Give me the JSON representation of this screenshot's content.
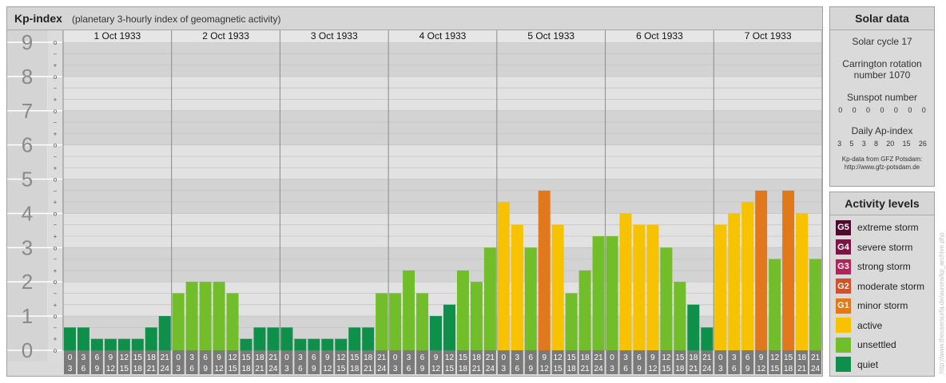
{
  "header": {
    "title": "Kp-index",
    "subtitle": "(planetary 3-hourly index of geomagnetic activity)"
  },
  "chart_data": {
    "type": "bar",
    "y_levels": [
      "0",
      "1",
      "2",
      "3",
      "4",
      "5",
      "6",
      "7",
      "8",
      "9"
    ],
    "y_minor_marks": [
      "o",
      "+",
      "−"
    ],
    "ylim": [
      0,
      9
    ],
    "days": [
      "1 Oct 1933",
      "2 Oct 1933",
      "3 Oct 1933",
      "4 Oct 1933",
      "5 Oct 1933",
      "6 Oct 1933",
      "7 Oct 1933"
    ],
    "interval_start_labels": [
      "0",
      "3",
      "6",
      "9",
      "12",
      "15",
      "18",
      "21"
    ],
    "interval_end_labels": [
      "3",
      "6",
      "9",
      "12",
      "15",
      "18",
      "21",
      "24"
    ],
    "kp_values": [
      [
        0.667,
        0.667,
        0.333,
        0.333,
        0.333,
        0.333,
        0.667,
        1.0
      ],
      [
        1.667,
        2.0,
        2.0,
        2.0,
        1.667,
        0.333,
        0.667,
        0.667
      ],
      [
        0.667,
        0.333,
        0.333,
        0.333,
        0.333,
        0.667,
        0.667,
        1.667
      ],
      [
        1.667,
        2.333,
        1.667,
        1.0,
        1.333,
        2.333,
        2.0,
        3.0
      ],
      [
        4.333,
        3.667,
        3.0,
        4.667,
        3.667,
        1.667,
        2.333,
        3.333
      ],
      [
        3.333,
        4.0,
        3.667,
        3.667,
        3.0,
        2.0,
        1.333,
        0.667
      ],
      [
        3.667,
        4.0,
        4.333,
        4.667,
        2.667,
        4.667,
        4.0,
        2.667
      ]
    ],
    "colors": {
      "quiet": "#0e8f4a",
      "unsettled": "#72bd2a",
      "active": "#f7c200",
      "G1": "#e2781c",
      "G2": "#d1512a",
      "G3": "#b0245a",
      "G4": "#7a1545",
      "G5": "#4e0b2e"
    }
  },
  "solar": {
    "title": "Solar data",
    "cycle": "Solar cycle 17",
    "carrington_line1": "Carrington rotation",
    "carrington_line2": "number 1070",
    "sunspot_label": "Sunspot number",
    "sunspot_values": [
      "0",
      "0",
      "0",
      "0",
      "0",
      "0",
      "0"
    ],
    "ap_label": "Daily Ap-index",
    "ap_values": [
      "3",
      "5",
      "3",
      "8",
      "20",
      "15",
      "26"
    ],
    "credit_line1": "Kp-data from GFZ Potsdam:",
    "credit_line2": "http://www.gfz-potsdam.de"
  },
  "activity": {
    "title": "Activity levels",
    "items": [
      {
        "badge": "G5",
        "label": "extreme storm",
        "color": "#4e0b2e"
      },
      {
        "badge": "G4",
        "label": "severe storm",
        "color": "#7a1545"
      },
      {
        "badge": "G3",
        "label": "strong storm",
        "color": "#b0245a"
      },
      {
        "badge": "G2",
        "label": "moderate storm",
        "color": "#d1512a"
      },
      {
        "badge": "G1",
        "label": "minor storm",
        "color": "#e2781c"
      },
      {
        "badge": "",
        "label": "active",
        "color": "#f7c200"
      },
      {
        "badge": "",
        "label": "unsettled",
        "color": "#72bd2a"
      },
      {
        "badge": "",
        "label": "quiet",
        "color": "#0e8f4a"
      }
    ]
  },
  "watermark": "http://www.theusersurfa.de/aurora/kp_archive.php"
}
